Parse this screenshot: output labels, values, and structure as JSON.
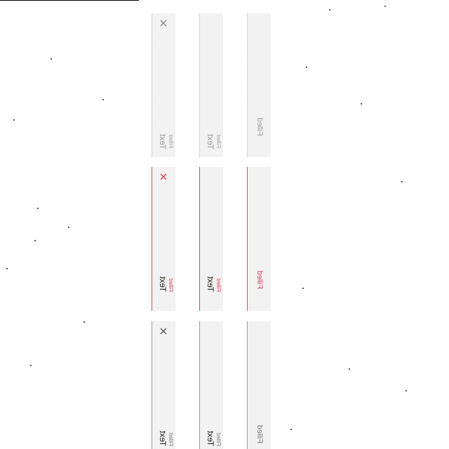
{
  "text_fields": {
    "disabled": {
      "with_clear": {
        "value": "Text",
        "label": "Filled"
      },
      "without_clear": {
        "value": "Text",
        "label": "Filled"
      },
      "label_only": {
        "label": "Filled"
      }
    },
    "error": {
      "with_clear": {
        "value": "Text",
        "label": "Filled"
      },
      "without_clear": {
        "value": "Text",
        "label": "Filled"
      },
      "label_only": {
        "label": "Filled"
      }
    },
    "default": {
      "with_clear": {
        "value": "Text",
        "label": "Filled"
      },
      "without_clear": {
        "value": "Text",
        "label": "Filled"
      },
      "label_only": {
        "label": "Filled"
      }
    }
  },
  "icons": {
    "clear": "close-icon"
  },
  "colors": {
    "field_background": "#f2f2f2",
    "error": "#d9465b",
    "disabled_text": "#9f9f9f",
    "default_text": "#1f1f1f"
  }
}
